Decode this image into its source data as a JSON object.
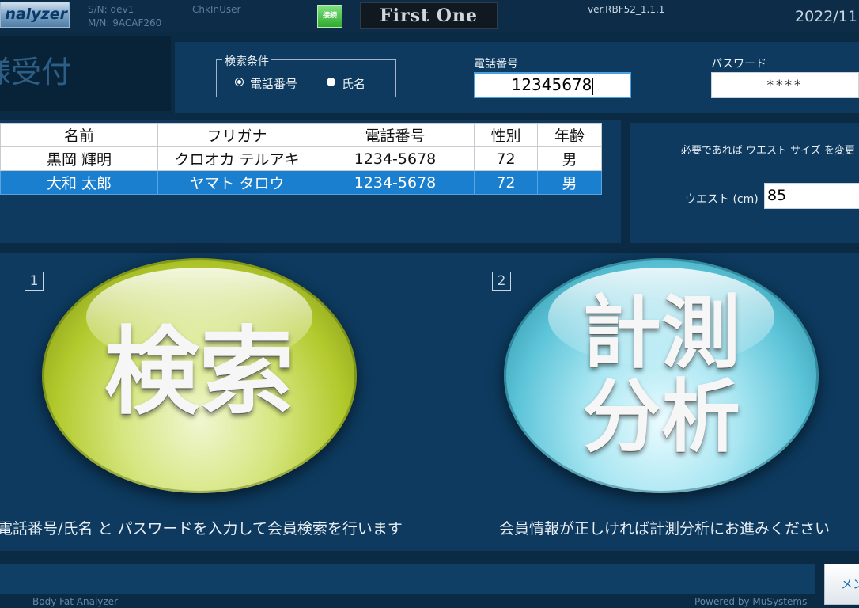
{
  "header": {
    "logo_text": "nalyzer",
    "serial_label": "S/N: dev1",
    "model_label": "M/N: 9ACAF260",
    "user_label": "ChkInUser",
    "connect_label": "接続",
    "brand": "First One",
    "version": "ver.RBF52_1.1.1",
    "date": "2022/11"
  },
  "page": {
    "title": "様受付"
  },
  "search": {
    "condition_label": "検索条件",
    "options": [
      {
        "label": "電話番号",
        "selected": true
      },
      {
        "label": "氏名",
        "selected": false
      }
    ],
    "phone_label": "電話番号",
    "phone_value": "12345678",
    "password_label": "パスワード",
    "password_value": "****"
  },
  "results": {
    "columns": [
      "名前",
      "フリガナ",
      "電話番号",
      "性別",
      "年齢"
    ],
    "rows": [
      {
        "name": "黒岡 輝明",
        "kana": "クロオカ テルアキ",
        "phone": "1234-5678",
        "gender": "72",
        "age": "男",
        "selected": false
      },
      {
        "name": "大和  太郎",
        "kana": "ヤマト  タロウ",
        "phone": "1234-5678",
        "gender": "72",
        "age": "男",
        "selected": true
      }
    ]
  },
  "waist": {
    "note": "必要であれば ウエスト サイズ を変更",
    "label": "ウエスト (cm)",
    "value": "85"
  },
  "actions": {
    "search": {
      "number": "1",
      "label": "検索",
      "caption": "電話番号/氏名 と パスワードを入力して会員検索を行います"
    },
    "measure": {
      "number": "2",
      "label_line1": "計測",
      "label_line2": "分析",
      "caption": "会員情報が正しければ計測分析にお進みください"
    }
  },
  "footer": {
    "menu_label": "メン",
    "app_name": "Body Fat Analyzer",
    "powered_by": "Powered by MuSystems"
  },
  "colors": {
    "background": "#0b2a44",
    "panel": "#0d3a5e",
    "selected_row": "#1a7fce",
    "search_button": "#b2c92c",
    "measure_button": "#5cc4d8"
  }
}
